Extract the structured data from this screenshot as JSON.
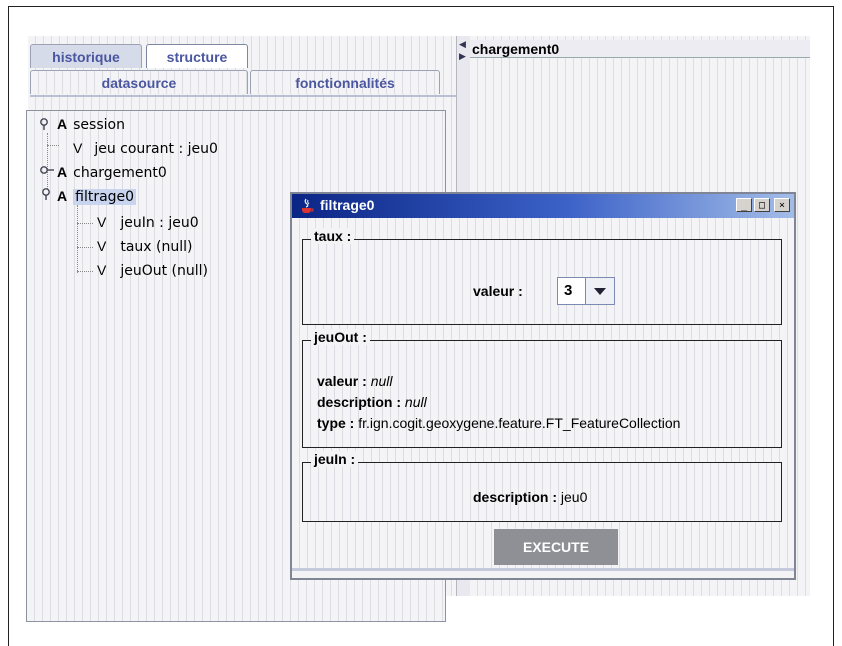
{
  "tabs": {
    "historique": "historique",
    "structure": "structure",
    "datasource": "datasource",
    "fonctionnalites": "fonctionnalités"
  },
  "tree": {
    "session": {
      "kind": "A",
      "label": "session"
    },
    "jeu_courant": {
      "kind": "V",
      "label": "jeu courant : jeu0"
    },
    "chargement0": {
      "kind": "A",
      "label": "chargement0"
    },
    "filtrage0": {
      "kind": "A",
      "label": "filtrage0"
    },
    "jeuIn": {
      "kind": "V",
      "label": "jeuIn : jeu0"
    },
    "taux": {
      "kind": "V",
      "label": "taux (null)"
    },
    "jeuOut": {
      "kind": "V",
      "label": "jeuOut (null)"
    }
  },
  "right_panel": {
    "title": "chargement0"
  },
  "dialog": {
    "title": "filtrage0",
    "buttons": {
      "minimize": "_",
      "maximize": "□",
      "close": "×"
    },
    "taux": {
      "legend": "taux :",
      "valeur_label": "valeur :",
      "valeur_value": "3"
    },
    "jeuOut": {
      "legend": "jeuOut :",
      "valeur_label": "valeur :",
      "valeur_value": "null",
      "description_label": "description :",
      "description_value": "null",
      "type_label": "type :",
      "type_value": "fr.ign.cogit.geoxygene.feature.FT_FeatureCollection"
    },
    "jeuIn": {
      "legend": "jeuIn :",
      "description_label": "description :",
      "description_value": "jeu0"
    },
    "execute_label": "EXECUTE"
  },
  "colors": {
    "tab_text": "#4a56a0",
    "titlebar_start": "#0b2585",
    "titlebar_end": "#a3bde8",
    "selection": "#c9d4ef",
    "execute_bg": "#8e9096"
  }
}
